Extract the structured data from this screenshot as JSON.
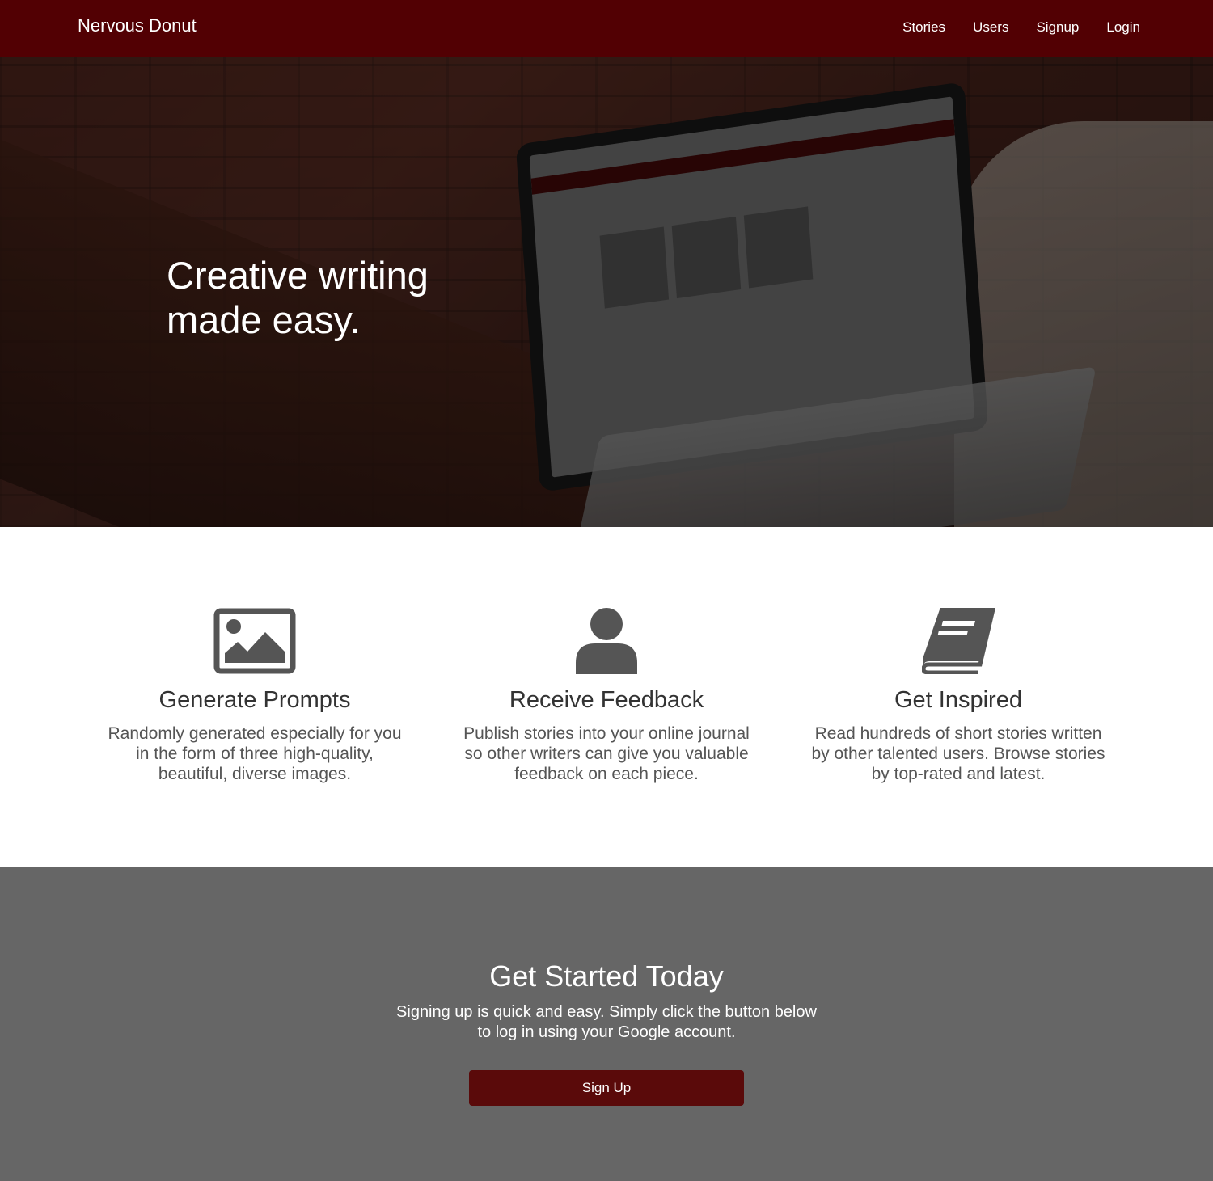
{
  "navbar": {
    "brand": "Nervous Donut",
    "links": [
      "Stories",
      "Users",
      "Signup",
      "Login"
    ]
  },
  "hero": {
    "title": "Creative writing made easy."
  },
  "features": [
    {
      "icon": "image-icon",
      "title": "Generate Prompts",
      "text": "Randomly generated especially for you in the form of three high-quality, beautiful, diverse images."
    },
    {
      "icon": "user-icon",
      "title": "Receive Feedback",
      "text": "Publish stories into your online journal so other writers can give you valuable feedback on each piece."
    },
    {
      "icon": "book-icon",
      "title": "Get Inspired",
      "text": "Read hundreds of short stories written by other talented users. Browse stories by top-rated and latest."
    }
  ],
  "cta": {
    "title": "Get Started Today",
    "text": "Signing up is quick and easy. Simply click the button below to log in using your Google account.",
    "button": "Sign Up"
  },
  "colors": {
    "navbar": "#520003",
    "cta_background": "#666666",
    "button": "#5a0a0a",
    "icon": "#555555"
  }
}
